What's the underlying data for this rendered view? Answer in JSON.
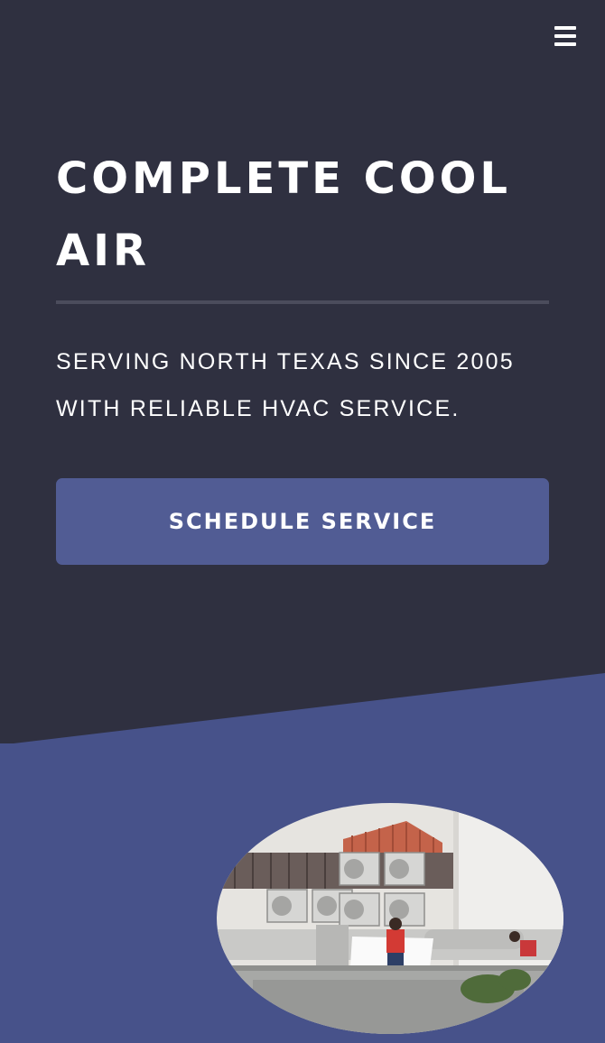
{
  "header": {
    "menu_icon": "hamburger-menu-icon"
  },
  "hero": {
    "title_line1": "COMPLETE COOL",
    "title_line2": "AIR",
    "subtitle_line1": "SERVING NORTH TEXAS SINCE 2005",
    "subtitle_line2": "WITH RELIABLE HVAC SERVICE.",
    "cta_label": "SCHEDULE SERVICE"
  },
  "section2": {
    "image_alt": "Technicians servicing rooftop HVAC condenser units"
  },
  "colors": {
    "background": "#2f3040",
    "accent": "#515c94",
    "section_band": "#47528a",
    "text": "#ffffff"
  }
}
